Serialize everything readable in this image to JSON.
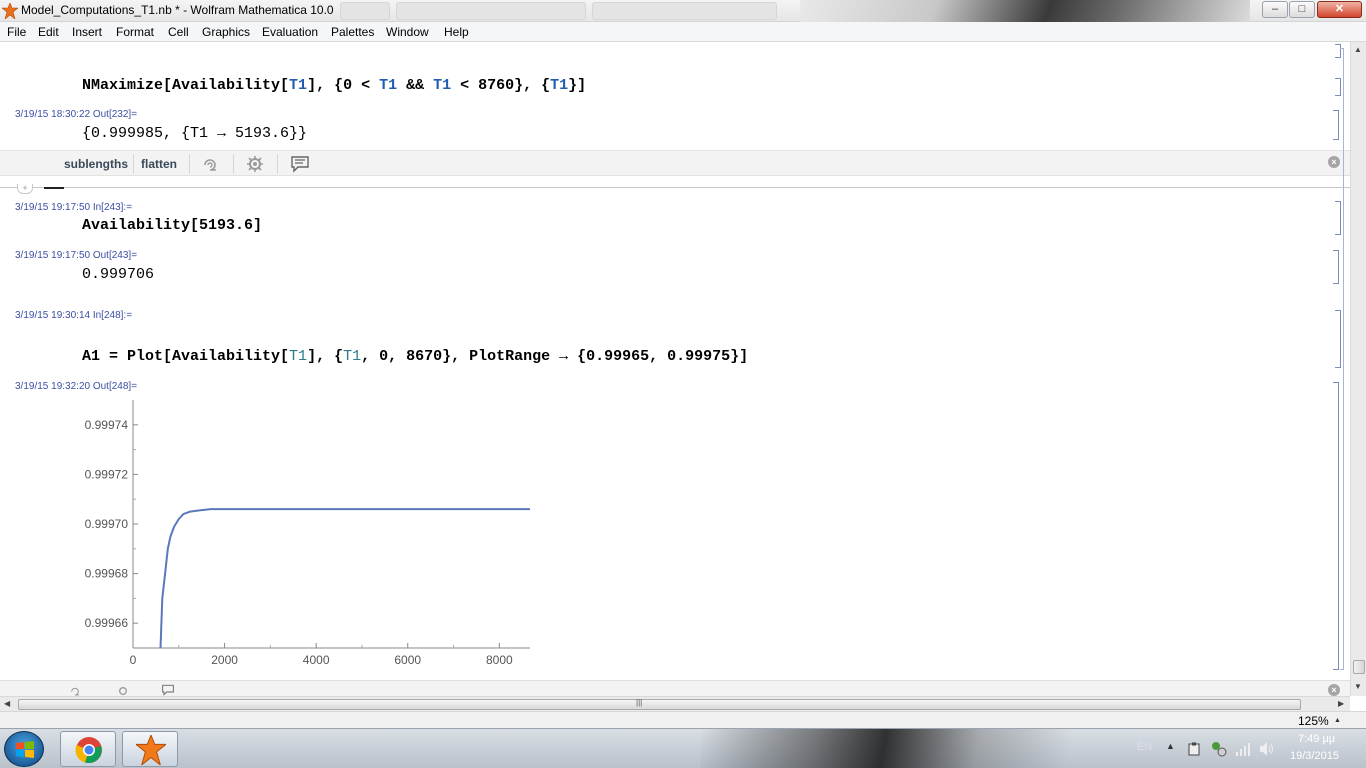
{
  "window": {
    "title": "Model_Computations_T1.nb * - Wolfram Mathematica 10.0",
    "buttons": {
      "minimize": "–",
      "restore": "□",
      "close": "✕"
    }
  },
  "menu": [
    "File",
    "Edit",
    "Insert",
    "Format",
    "Cell",
    "Graphics",
    "Evaluation",
    "Palettes",
    "Window",
    "Help"
  ],
  "cells": [
    {
      "input": {
        "p1": "NMaximize[Availability[",
        "s1": "T1",
        "p2": "], {0 < ",
        "s2": "T1",
        "p3": " && ",
        "s3": "T1",
        "p4": " < 8760}, {",
        "s4": "T1",
        "p5": "}]"
      }
    },
    {
      "out_label": "3/19/15 18:30:22 Out[232]=",
      "output": "{0.999985, {T1 → 5193.6}}"
    },
    {
      "in_label": "3/19/15 19:17:50 In[243]:=",
      "input": "Availability[5193.6]"
    },
    {
      "out_label": "3/19/15 19:17:50 Out[243]=",
      "output": "0.999706"
    },
    {
      "in_label": "3/19/15 19:30:14 In[248]:=",
      "input": {
        "p1": "A1 = Plot[Availability[",
        "s1": "T1",
        "p2": "], {",
        "s2": "T1",
        "p3": ", 0, 8670}, PlotRange → {0.99965, 0.99975}]"
      }
    },
    {
      "out_label": "3/19/15 19:32:20 Out[248]="
    }
  ],
  "suggestions": {
    "items": [
      "sublengths",
      "flatten"
    ],
    "icons": [
      "swirl-icon",
      "gear-icon",
      "comment-icon"
    ]
  },
  "chart_data": {
    "type": "line",
    "title": "",
    "xlabel": "",
    "ylabel": "",
    "xlim": [
      0,
      8670
    ],
    "ylim": [
      0.99965,
      0.99975
    ],
    "x_ticks": [
      "0",
      "2000",
      "4000",
      "6000",
      "8000"
    ],
    "y_ticks": [
      "0.99966",
      "0.99968",
      "0.99970",
      "0.99972",
      "0.99974"
    ],
    "series": [
      {
        "color": "#5b78bb",
        "x": [
          600,
          640,
          700,
          760,
          820,
          900,
          1000,
          1100,
          1250,
          1450,
          1700,
          2000,
          3000,
          4000,
          5000,
          6000,
          7000,
          8000,
          8670
        ],
        "y": [
          0.99965,
          0.99967,
          0.99968,
          0.99969,
          0.999695,
          0.999699,
          0.999702,
          0.999704,
          0.999705,
          0.9997055,
          0.999706,
          0.999706,
          0.999706,
          0.999706,
          0.999706,
          0.999706,
          0.999706,
          0.999706,
          0.999706
        ]
      }
    ]
  },
  "status": {
    "zoom": "125%"
  },
  "taskbar": {
    "language": "EN",
    "time": "7:49 μμ",
    "date": "19/3/2015"
  }
}
